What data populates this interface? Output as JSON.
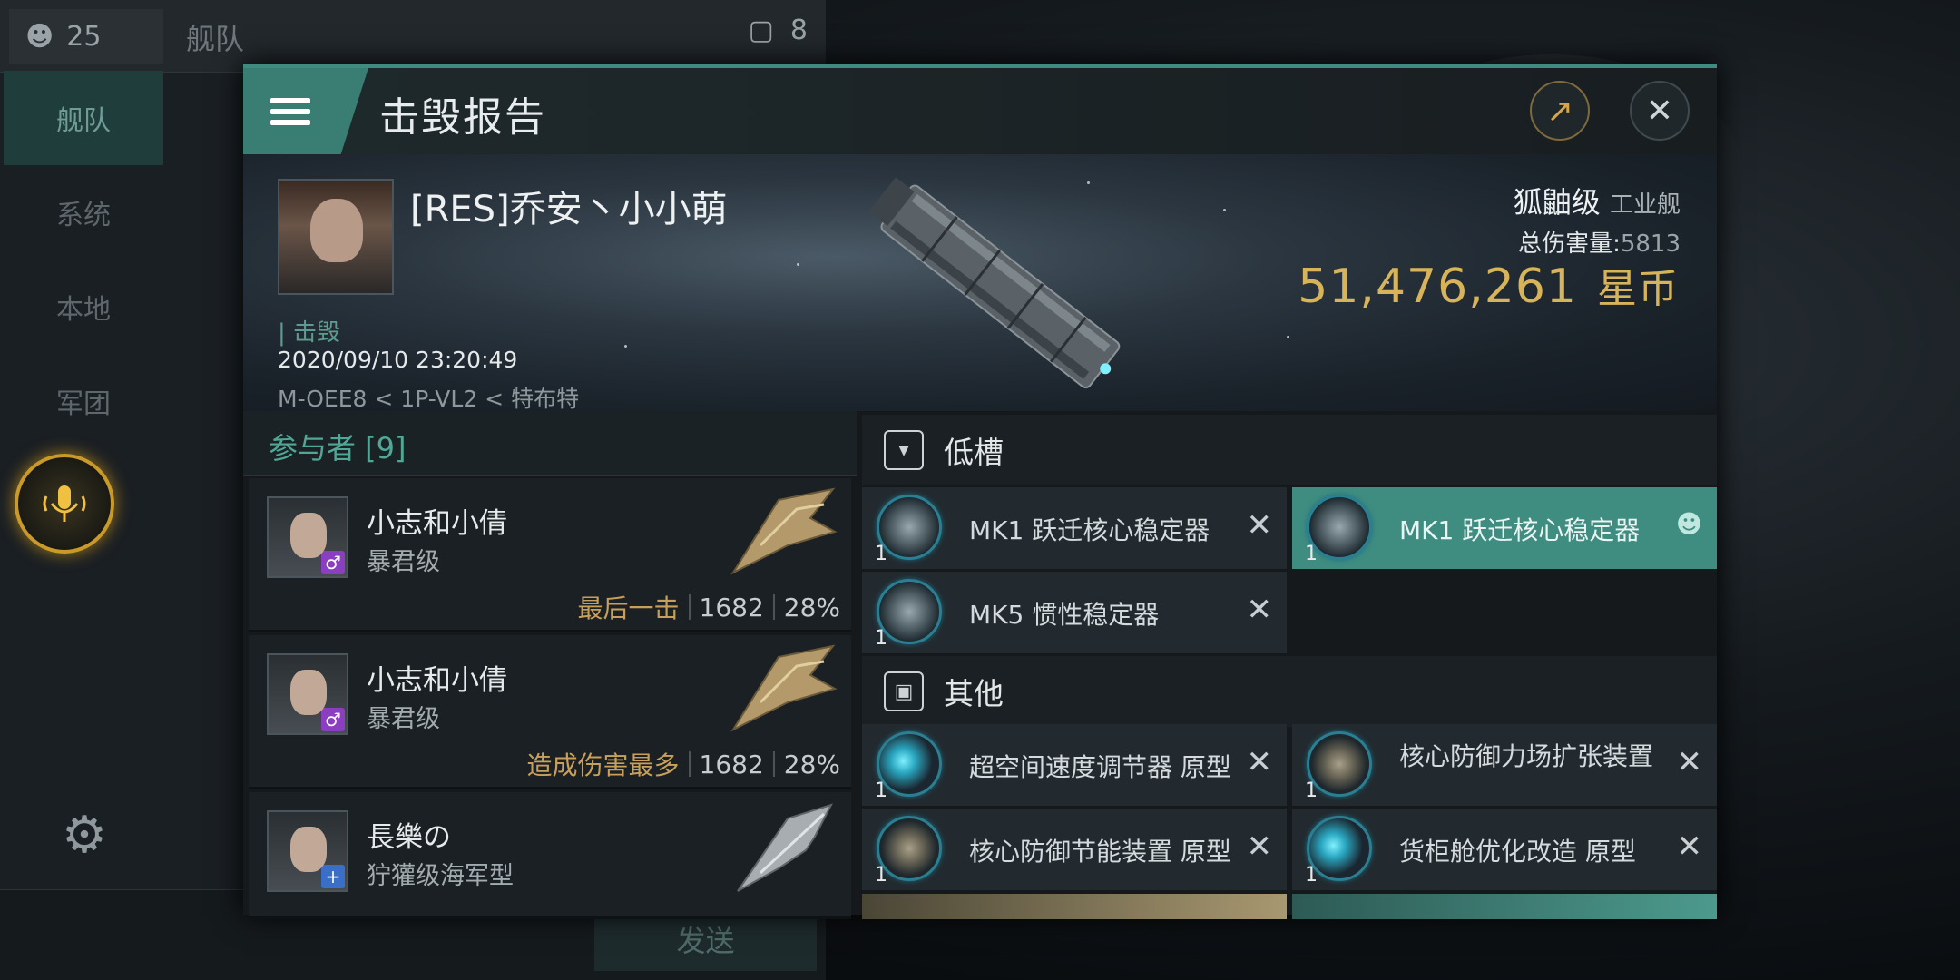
{
  "chat": {
    "people_count": "25",
    "title": "舰队",
    "message_count": "8",
    "sidebar": [
      "舰队",
      "系统",
      "本地",
      "军团"
    ],
    "send_label": "发送"
  },
  "dialog": {
    "title": "击毁报告",
    "share_icon": "share-icon",
    "close_icon": "close-icon"
  },
  "victim": {
    "name": "[RES]乔安丶小小萌",
    "kill_type": "击毁",
    "time": "2020/09/10 23:20:49",
    "location": "M-OEE8 < 1P-VL2 < 特布特",
    "ship_class": "狐鼬级",
    "ship_category": "工业舰",
    "damage_label": "总伤害量:",
    "damage_value": "5813",
    "isk_value": "51,476,261",
    "isk_unit": "星币"
  },
  "participants": {
    "header": "参与者 [9]",
    "items": [
      {
        "name": "小志和小倩",
        "ship": "暴君级",
        "tag": "最后一击",
        "damage": "1682",
        "percent": "28%"
      },
      {
        "name": "小志和小倩",
        "ship": "暴君级",
        "tag": "造成伤害最多",
        "damage": "1682",
        "percent": "28%"
      },
      {
        "name": "長樂の",
        "ship": "狞獾级海军型",
        "tag": "",
        "damage": "",
        "percent": ""
      }
    ]
  },
  "modules": {
    "low_slot_title": "低槽",
    "other_title": "其他",
    "low_slots": [
      {
        "name": "MK1 跃迁核心稳定器",
        "qty": "1"
      },
      {
        "name": "MK1 跃迁核心稳定器",
        "qty": "1"
      },
      {
        "name": "MK5 惯性稳定器",
        "qty": "1"
      }
    ],
    "other": [
      {
        "name": "超空间速度调节器 原型",
        "qty": "1"
      },
      {
        "name": "核心防御力场扩张装置",
        "qty": "1"
      },
      {
        "name": "核心防御节能装置 原型",
        "qty": "1"
      },
      {
        "name": "货柜舱优化改造 原型",
        "qty": "1"
      }
    ]
  },
  "colors": {
    "accent": "#3f8d80",
    "gold": "#d7b45a",
    "mic": "#c99a2a"
  }
}
